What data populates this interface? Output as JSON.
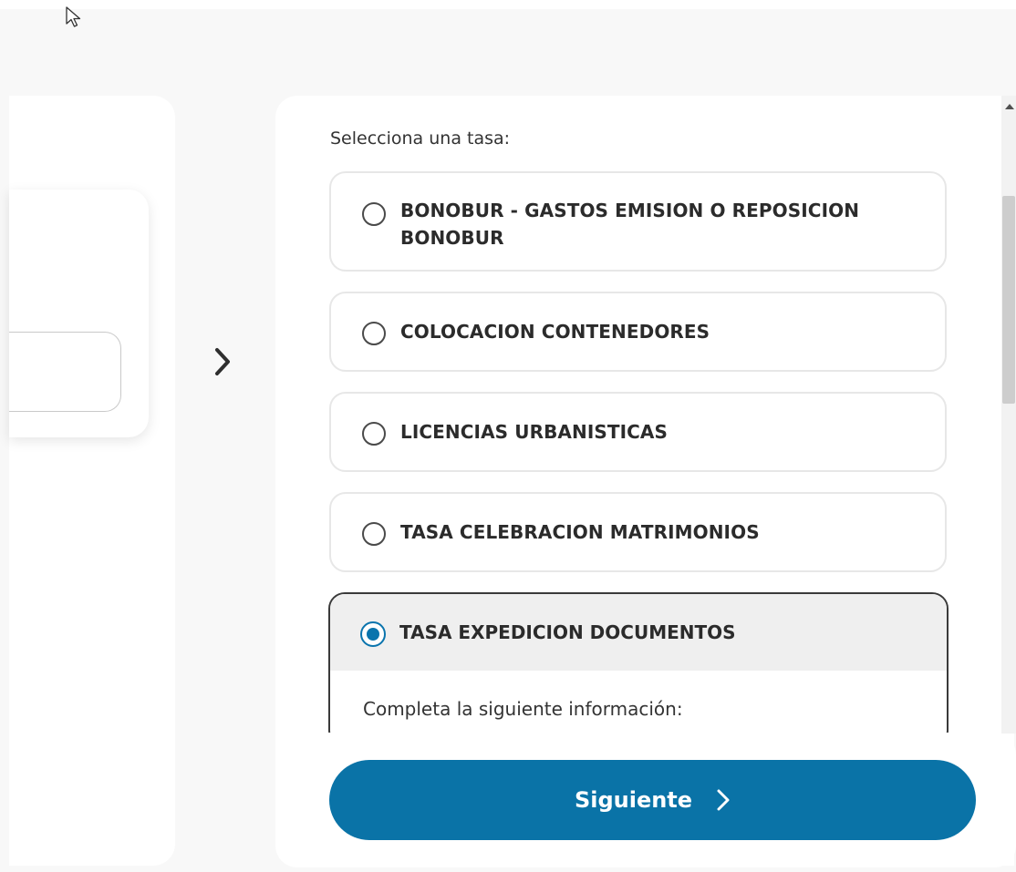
{
  "panel": {
    "heading": "Selecciona una tasa:",
    "options": [
      {
        "label": "BONOBUR - GASTOS EMISION O REPOSICION BONOBUR",
        "selected": false
      },
      {
        "label": "COLOCACION CONTENEDORES",
        "selected": false
      },
      {
        "label": "LICENCIAS URBANISTICAS",
        "selected": false
      },
      {
        "label": "TASA CELEBRACION MATRIMONIOS",
        "selected": false
      },
      {
        "label": "TASA EXPEDICION DOCUMENTOS",
        "selected": true
      }
    ],
    "selected_info": "Completa la siguiente información:"
  },
  "footer": {
    "next_label": "Siguiente"
  },
  "colors": {
    "accent": "#0a73a7",
    "radio_checked": "#0a74ad",
    "selected_header_bg": "#efefef"
  },
  "icons": {
    "cursor": "mouse-pointer-icon",
    "between_panels": "chevron-right-icon",
    "button": "chevron-right-icon"
  }
}
